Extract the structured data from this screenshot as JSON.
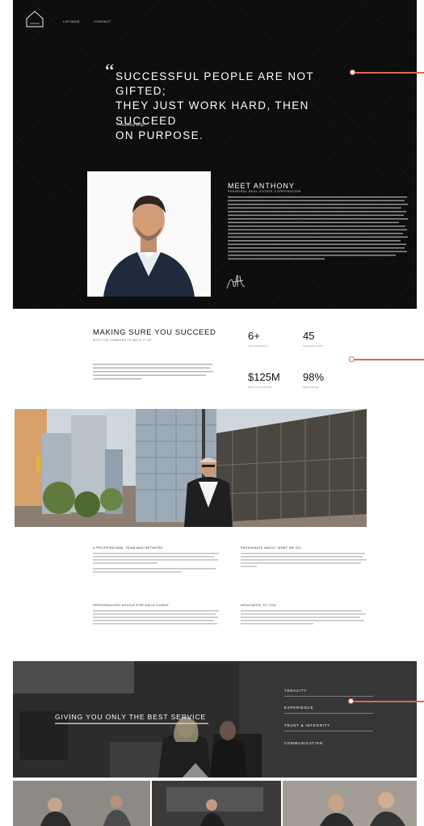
{
  "nav": {
    "items": [
      "LISTINGS",
      "CONTACT"
    ]
  },
  "hero": {
    "quote_lines": [
      "SUCCESSFUL PEOPLE ARE NOT GIFTED;",
      "THEY JUST WORK HARD, THEN SUCCEED",
      "ON PURPOSE."
    ],
    "author": "—Anthony Drlje"
  },
  "meet": {
    "title": "MEET ANTHONY",
    "subtitle": "PERSONAL REAL ESTATE CORPORATION"
  },
  "stats": {
    "title": "MAKING SURE YOU SUCCEED",
    "subtitle": "WITH THE NUMBERS TO BACK IT UP",
    "items": [
      {
        "value": "6+",
        "label": "Years of Experience"
      },
      {
        "value": "45",
        "label": "Transactions in 2019"
      },
      {
        "value": "$125M",
        "label": "Sales volume since 2019"
      },
      {
        "value": "98%",
        "label": "Sales to list ratio"
      }
    ]
  },
  "features": [
    {
      "heading": "A PROFESSIONAL TEAM AND NETWORK"
    },
    {
      "heading": "PASSIONATE ABOUT WHAT WE DO"
    },
    {
      "heading": "PERSONALIZED ADVICE FOR EACH CLIENT"
    },
    {
      "heading": "DEDICATED TO YOU"
    }
  ],
  "service": {
    "title": "GIVING YOU ONLY THE BEST SERVICE",
    "items": [
      "TENACITY",
      "EXPERIENCE",
      "TRUST & INTEGRITY",
      "COMMUNICATION"
    ]
  },
  "colors": {
    "annotation": "#e0664a",
    "hero_bg": "#0d0d0d"
  }
}
